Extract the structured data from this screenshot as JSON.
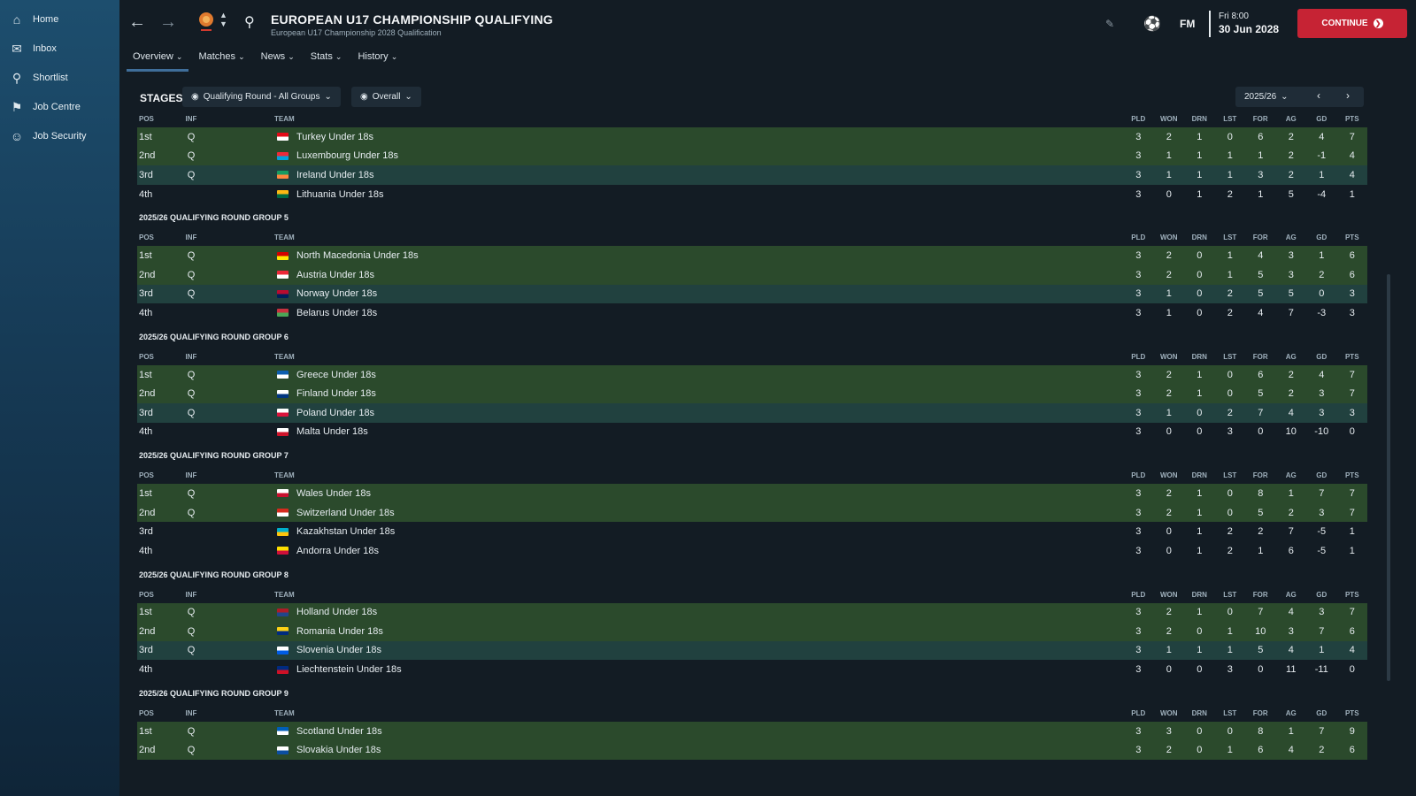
{
  "sidebar": {
    "items": [
      {
        "label": "Home",
        "icon": "home-icon"
      },
      {
        "label": "Inbox",
        "icon": "inbox-icon"
      },
      {
        "label": "Shortlist",
        "icon": "search-icon"
      },
      {
        "label": "Job Centre",
        "icon": "job-centre-icon"
      },
      {
        "label": "Job Security",
        "icon": "job-security-icon"
      }
    ]
  },
  "header": {
    "title": "EUROPEAN U17 CHAMPIONSHIP QUALIFYING",
    "subtitle": "European U17 Championship 2028 Qualification",
    "date_day": "Fri 8:00",
    "date_full": "30 Jun 2028",
    "fm_label": "FM",
    "continue_label": "CONTINUE"
  },
  "tabs": [
    {
      "label": "Overview",
      "active": true
    },
    {
      "label": "Matches"
    },
    {
      "label": "News"
    },
    {
      "label": "Stats"
    },
    {
      "label": "History"
    }
  ],
  "stages": {
    "label": "STAGES",
    "filter_stage": "Qualifying Round - All Groups",
    "filter_view": "Overall",
    "season": "2025/26"
  },
  "columns": [
    "POS",
    "INF",
    "TEAM",
    "PLD",
    "WON",
    "DRN",
    "LST",
    "FOR",
    "AG",
    "GD",
    "PTS"
  ],
  "groups": [
    {
      "title": "",
      "rows": [
        {
          "pos": "1st",
          "inf": "Q",
          "team": "Turkey Under 18s",
          "flag": [
            "#e30a17",
            "#fff"
          ],
          "s": "g",
          "v": [
            "3",
            "2",
            "1",
            "0",
            "6",
            "2",
            "4",
            "7"
          ]
        },
        {
          "pos": "2nd",
          "inf": "Q",
          "team": "Luxembourg Under 18s",
          "flag": [
            "#ed2939",
            "#00a1de"
          ],
          "s": "g",
          "v": [
            "3",
            "1",
            "1",
            "1",
            "1",
            "2",
            "-1",
            "4"
          ]
        },
        {
          "pos": "3rd",
          "inf": "Q",
          "team": "Ireland Under 18s",
          "flag": [
            "#169b62",
            "#ff883e"
          ],
          "s": "b",
          "v": [
            "3",
            "1",
            "1",
            "1",
            "3",
            "2",
            "1",
            "4"
          ]
        },
        {
          "pos": "4th",
          "inf": "",
          "team": "Lithuania Under 18s",
          "flag": [
            "#fdb913",
            "#006a44"
          ],
          "s": "n",
          "v": [
            "3",
            "0",
            "1",
            "2",
            "1",
            "5",
            "-4",
            "1"
          ]
        }
      ]
    },
    {
      "title": "2025/26 QUALIFYING ROUND GROUP 5",
      "rows": [
        {
          "pos": "1st",
          "inf": "Q",
          "team": "North Macedonia Under 18s",
          "flag": [
            "#d20000",
            "#ffe600"
          ],
          "s": "g",
          "v": [
            "3",
            "2",
            "0",
            "1",
            "4",
            "3",
            "1",
            "6"
          ]
        },
        {
          "pos": "2nd",
          "inf": "Q",
          "team": "Austria Under 18s",
          "flag": [
            "#ed2939",
            "#fff"
          ],
          "s": "g",
          "v": [
            "3",
            "2",
            "0",
            "1",
            "5",
            "3",
            "2",
            "6"
          ]
        },
        {
          "pos": "3rd",
          "inf": "Q",
          "team": "Norway Under 18s",
          "flag": [
            "#ba0c2f",
            "#00205b"
          ],
          "s": "b",
          "v": [
            "3",
            "1",
            "0",
            "2",
            "5",
            "5",
            "0",
            "3"
          ]
        },
        {
          "pos": "4th",
          "inf": "",
          "team": "Belarus Under 18s",
          "flag": [
            "#c8313e",
            "#4aa657"
          ],
          "s": "n",
          "v": [
            "3",
            "1",
            "0",
            "2",
            "4",
            "7",
            "-3",
            "3"
          ]
        }
      ]
    },
    {
      "title": "2025/26 QUALIFYING ROUND GROUP 6",
      "rows": [
        {
          "pos": "1st",
          "inf": "Q",
          "team": "Greece Under 18s",
          "flag": [
            "#0d5eaf",
            "#fff"
          ],
          "s": "g",
          "v": [
            "3",
            "2",
            "1",
            "0",
            "6",
            "2",
            "4",
            "7"
          ]
        },
        {
          "pos": "2nd",
          "inf": "Q",
          "team": "Finland Under 18s",
          "flag": [
            "#fff",
            "#003580"
          ],
          "s": "g",
          "v": [
            "3",
            "2",
            "1",
            "0",
            "5",
            "2",
            "3",
            "7"
          ]
        },
        {
          "pos": "3rd",
          "inf": "Q",
          "team": "Poland Under 18s",
          "flag": [
            "#fff",
            "#dc143c"
          ],
          "s": "b",
          "v": [
            "3",
            "1",
            "0",
            "2",
            "7",
            "4",
            "3",
            "3"
          ]
        },
        {
          "pos": "4th",
          "inf": "",
          "team": "Malta Under 18s",
          "flag": [
            "#fff",
            "#cf142b"
          ],
          "s": "n",
          "v": [
            "3",
            "0",
            "0",
            "3",
            "0",
            "10",
            "-10",
            "0"
          ]
        }
      ]
    },
    {
      "title": "2025/26 QUALIFYING ROUND GROUP 7",
      "rows": [
        {
          "pos": "1st",
          "inf": "Q",
          "team": "Wales Under 18s",
          "flag": [
            "#fff",
            "#c8102e"
          ],
          "s": "g",
          "v": [
            "3",
            "2",
            "1",
            "0",
            "8",
            "1",
            "7",
            "7"
          ]
        },
        {
          "pos": "2nd",
          "inf": "Q",
          "team": "Switzerland Under 18s",
          "flag": [
            "#d52b1e",
            "#fff"
          ],
          "s": "g",
          "v": [
            "3",
            "2",
            "1",
            "0",
            "5",
            "2",
            "3",
            "7"
          ]
        },
        {
          "pos": "3rd",
          "inf": "",
          "team": "Kazakhstan Under 18s",
          "flag": [
            "#00afca",
            "#fec50c"
          ],
          "s": "n",
          "v": [
            "3",
            "0",
            "1",
            "2",
            "2",
            "7",
            "-5",
            "1"
          ]
        },
        {
          "pos": "4th",
          "inf": "",
          "team": "Andorra Under 18s",
          "flag": [
            "#fedf00",
            "#d0103a"
          ],
          "s": "n",
          "v": [
            "3",
            "0",
            "1",
            "2",
            "1",
            "6",
            "-5",
            "1"
          ]
        }
      ]
    },
    {
      "title": "2025/26 QUALIFYING ROUND GROUP 8",
      "rows": [
        {
          "pos": "1st",
          "inf": "Q",
          "team": "Holland Under 18s",
          "flag": [
            "#ae1c28",
            "#21468b"
          ],
          "s": "g",
          "v": [
            "3",
            "2",
            "1",
            "0",
            "7",
            "4",
            "3",
            "7"
          ]
        },
        {
          "pos": "2nd",
          "inf": "Q",
          "team": "Romania Under 18s",
          "flag": [
            "#fcd116",
            "#002b7f"
          ],
          "s": "g",
          "v": [
            "3",
            "2",
            "0",
            "1",
            "10",
            "3",
            "7",
            "6"
          ]
        },
        {
          "pos": "3rd",
          "inf": "Q",
          "team": "Slovenia Under 18s",
          "flag": [
            "#fff",
            "#005ce5"
          ],
          "s": "b",
          "v": [
            "3",
            "1",
            "1",
            "1",
            "5",
            "4",
            "1",
            "4"
          ]
        },
        {
          "pos": "4th",
          "inf": "",
          "team": "Liechtenstein Under 18s",
          "flag": [
            "#002b7f",
            "#ce1126"
          ],
          "s": "n",
          "v": [
            "3",
            "0",
            "0",
            "3",
            "0",
            "11",
            "-11",
            "0"
          ]
        }
      ]
    },
    {
      "title": "2025/26 QUALIFYING ROUND GROUP 9",
      "rows": [
        {
          "pos": "1st",
          "inf": "Q",
          "team": "Scotland Under 18s",
          "flag": [
            "#005eb8",
            "#fff"
          ],
          "s": "g",
          "v": [
            "3",
            "3",
            "0",
            "0",
            "8",
            "1",
            "7",
            "9"
          ]
        },
        {
          "pos": "2nd",
          "inf": "Q",
          "team": "Slovakia Under 18s",
          "flag": [
            "#fff",
            "#0b4ea2"
          ],
          "s": "g",
          "v": [
            "3",
            "2",
            "0",
            "1",
            "6",
            "4",
            "2",
            "6"
          ]
        }
      ]
    }
  ]
}
